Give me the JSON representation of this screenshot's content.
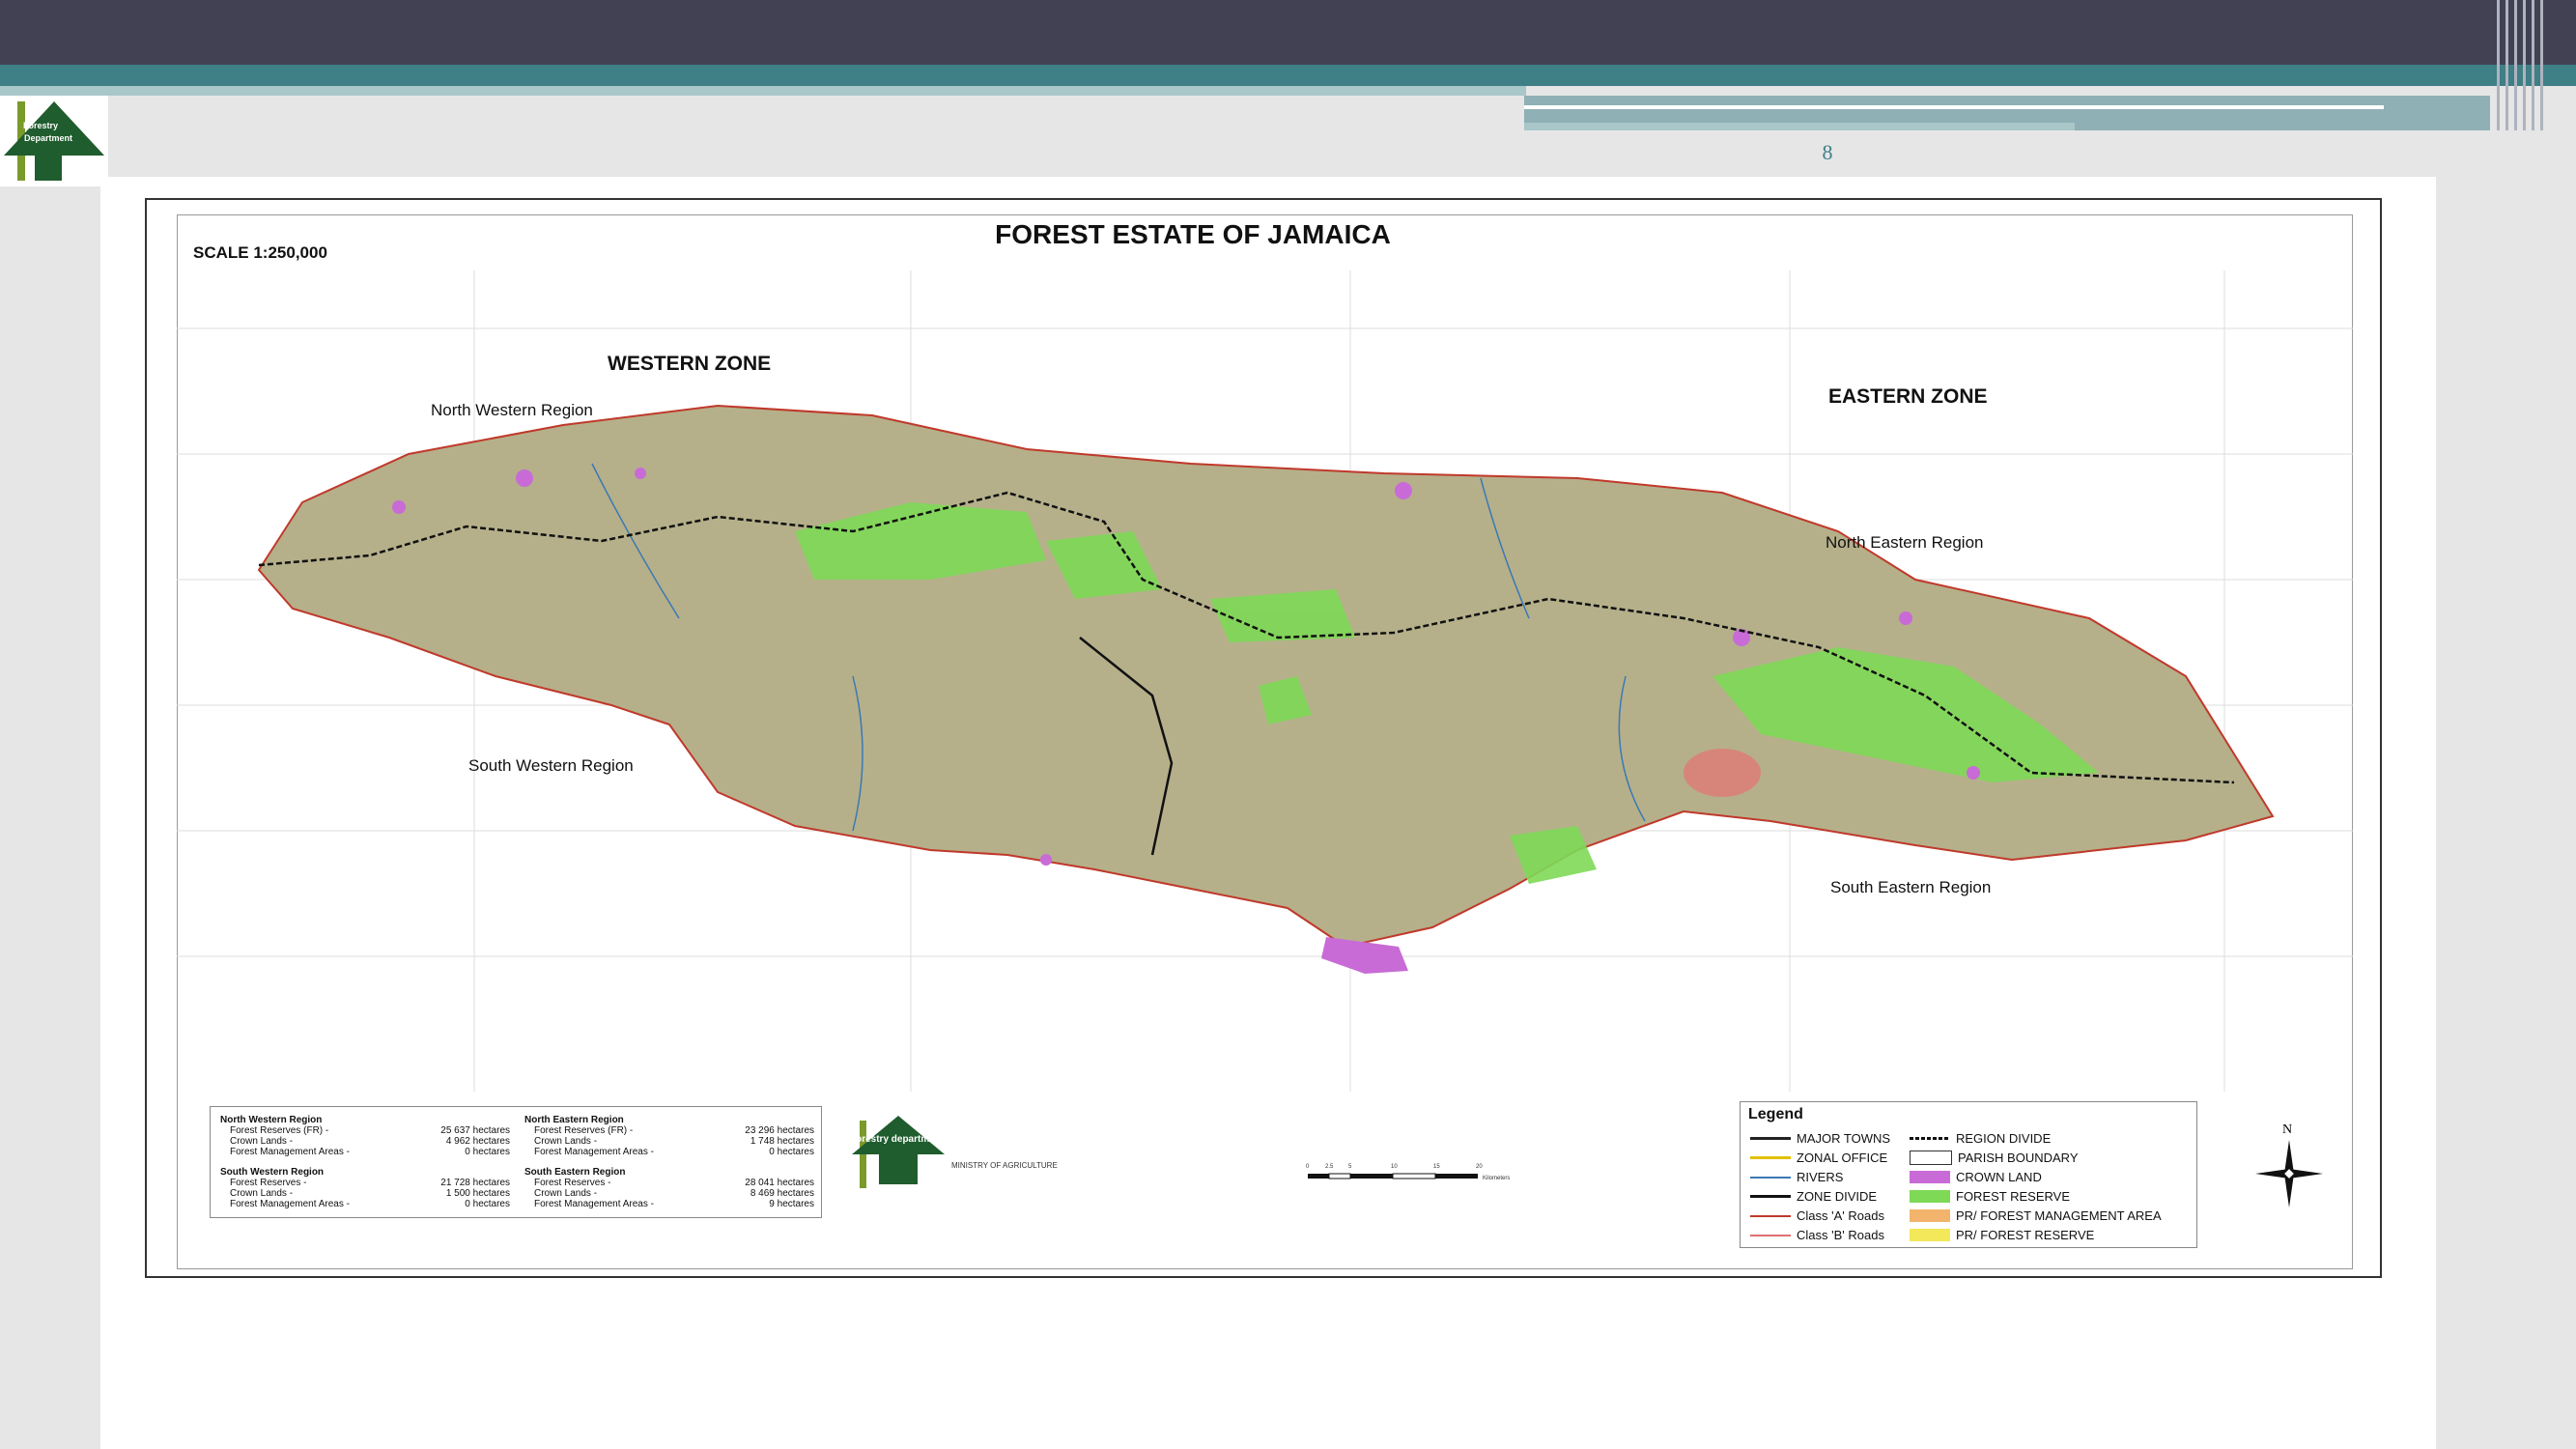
{
  "page_number": "8",
  "map": {
    "title": "FOREST ESTATE OF JAMAICA",
    "scale": "SCALE 1:250,000",
    "zones": {
      "western": "WESTERN ZONE",
      "eastern": "EASTERN ZONE"
    },
    "regions": {
      "north_western": "North Western Region",
      "south_western": "South Western Region",
      "north_eastern": "North Eastern Region",
      "south_eastern": "South Eastern Region"
    },
    "compass_label": "N"
  },
  "stats": [
    {
      "region": "North Western Region",
      "rows": [
        {
          "label": "Forest Reserves (FR) -",
          "value": "25 637 hectares"
        },
        {
          "label": "Crown Lands -",
          "value": "4 962 hectares"
        },
        {
          "label": "Forest Management Areas -",
          "value": "0 hectares"
        }
      ]
    },
    {
      "region": "North Eastern Region",
      "rows": [
        {
          "label": "Forest Reserves (FR) -",
          "value": "23 296 hectares"
        },
        {
          "label": "Crown Lands -",
          "value": "1 748 hectares"
        },
        {
          "label": "Forest Management Areas -",
          "value": "0 hectares"
        }
      ]
    },
    {
      "region": "South Western Region",
      "rows": [
        {
          "label": "Forest Reserves -",
          "value": "21 728 hectares"
        },
        {
          "label": "Crown Lands -",
          "value": "1 500 hectares"
        },
        {
          "label": "Forest Management Areas -",
          "value": "0 hectares"
        }
      ]
    },
    {
      "region": "South Eastern Region",
      "rows": [
        {
          "label": "Forest Reserves -",
          "value": "28 041 hectares"
        },
        {
          "label": "Crown Lands -",
          "value": "8 469 hectares"
        },
        {
          "label": "Forest Management Areas -",
          "value": "9 hectares"
        }
      ]
    }
  ],
  "legend": {
    "title": "Legend",
    "items": [
      {
        "label": "MAJOR TOWNS",
        "color": "#222222"
      },
      {
        "label": "REGION DIVIDE",
        "color": "#111111"
      },
      {
        "label": "ZONAL OFFICE",
        "color": "#e3c000"
      },
      {
        "label": "PARISH BOUNDARY",
        "color": "#ffffff"
      },
      {
        "label": "RIVERS",
        "color": "#3a78b5"
      },
      {
        "label": "CROWN LAND",
        "color": "#c86bd6"
      },
      {
        "label": "ZONE DIVIDE",
        "color": "#111111"
      },
      {
        "label": "FOREST RESERVE",
        "color": "#7ed957"
      },
      {
        "label": "Class 'A' Roads",
        "color": "#c0392b"
      },
      {
        "label": "PR/ FOREST MANAGEMENT AREA",
        "color": "#f2b46d"
      },
      {
        "label": "Class 'B' Roads",
        "color": "#e07070"
      },
      {
        "label": "PR/ FOREST RESERVE",
        "color": "#f2e85a"
      }
    ]
  },
  "scalebar": {
    "ticks": [
      "0",
      "2.5",
      "5",
      "10",
      "15",
      "20"
    ],
    "unit": "Kilometers"
  },
  "credit": {
    "org": "forestry department",
    "ministry": "MINISTRY OF AGRICULTURE"
  },
  "logo": {
    "line1": "Forestry",
    "line2": "Department"
  }
}
